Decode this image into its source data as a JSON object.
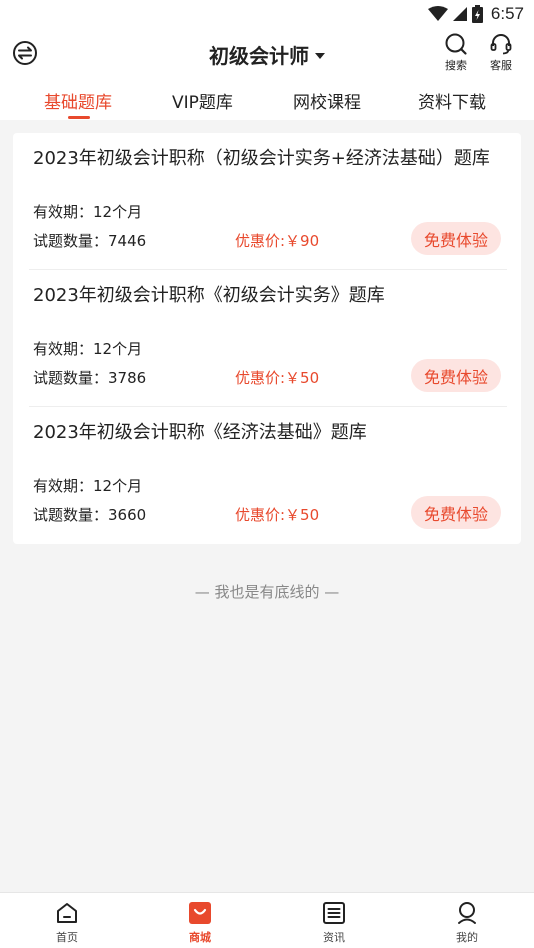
{
  "status_bar": {
    "time": "6:57"
  },
  "header": {
    "title": "初级会计师",
    "search_label": "搜索",
    "service_label": "客服"
  },
  "tabs": [
    {
      "label": "基础题库",
      "active": true
    },
    {
      "label": "VIP题库",
      "active": false
    },
    {
      "label": "网校课程",
      "active": false
    },
    {
      "label": "资料下载",
      "active": false
    }
  ],
  "products": [
    {
      "title": "2023年初级会计职称（初级会计实务+经济法基础）题库",
      "validity": "有效期：12个月",
      "count": "试题数量：7446",
      "price": "优惠价:￥90",
      "button": "免费体验"
    },
    {
      "title": "2023年初级会计职称《初级会计实务》题库",
      "validity": "有效期：12个月",
      "count": "试题数量：3786",
      "price": "优惠价:￥50",
      "button": "免费体验"
    },
    {
      "title": "2023年初级会计职称《经济法基础》题库",
      "validity": "有效期：12个月",
      "count": "试题数量：3660",
      "price": "优惠价:￥50",
      "button": "免费体验"
    }
  ],
  "footer_note": "— 我也是有底线的 —",
  "bottom_nav": [
    {
      "label": "首页",
      "icon": "home-icon",
      "active": false
    },
    {
      "label": "商城",
      "icon": "shop-bag-icon",
      "active": true
    },
    {
      "label": "资讯",
      "icon": "news-icon",
      "active": false
    },
    {
      "label": "我的",
      "icon": "profile-icon",
      "active": false
    }
  ],
  "colors": {
    "accent": "#e8492d",
    "button_bg": "#fde4e1",
    "page_bg": "#f4f4f4"
  }
}
